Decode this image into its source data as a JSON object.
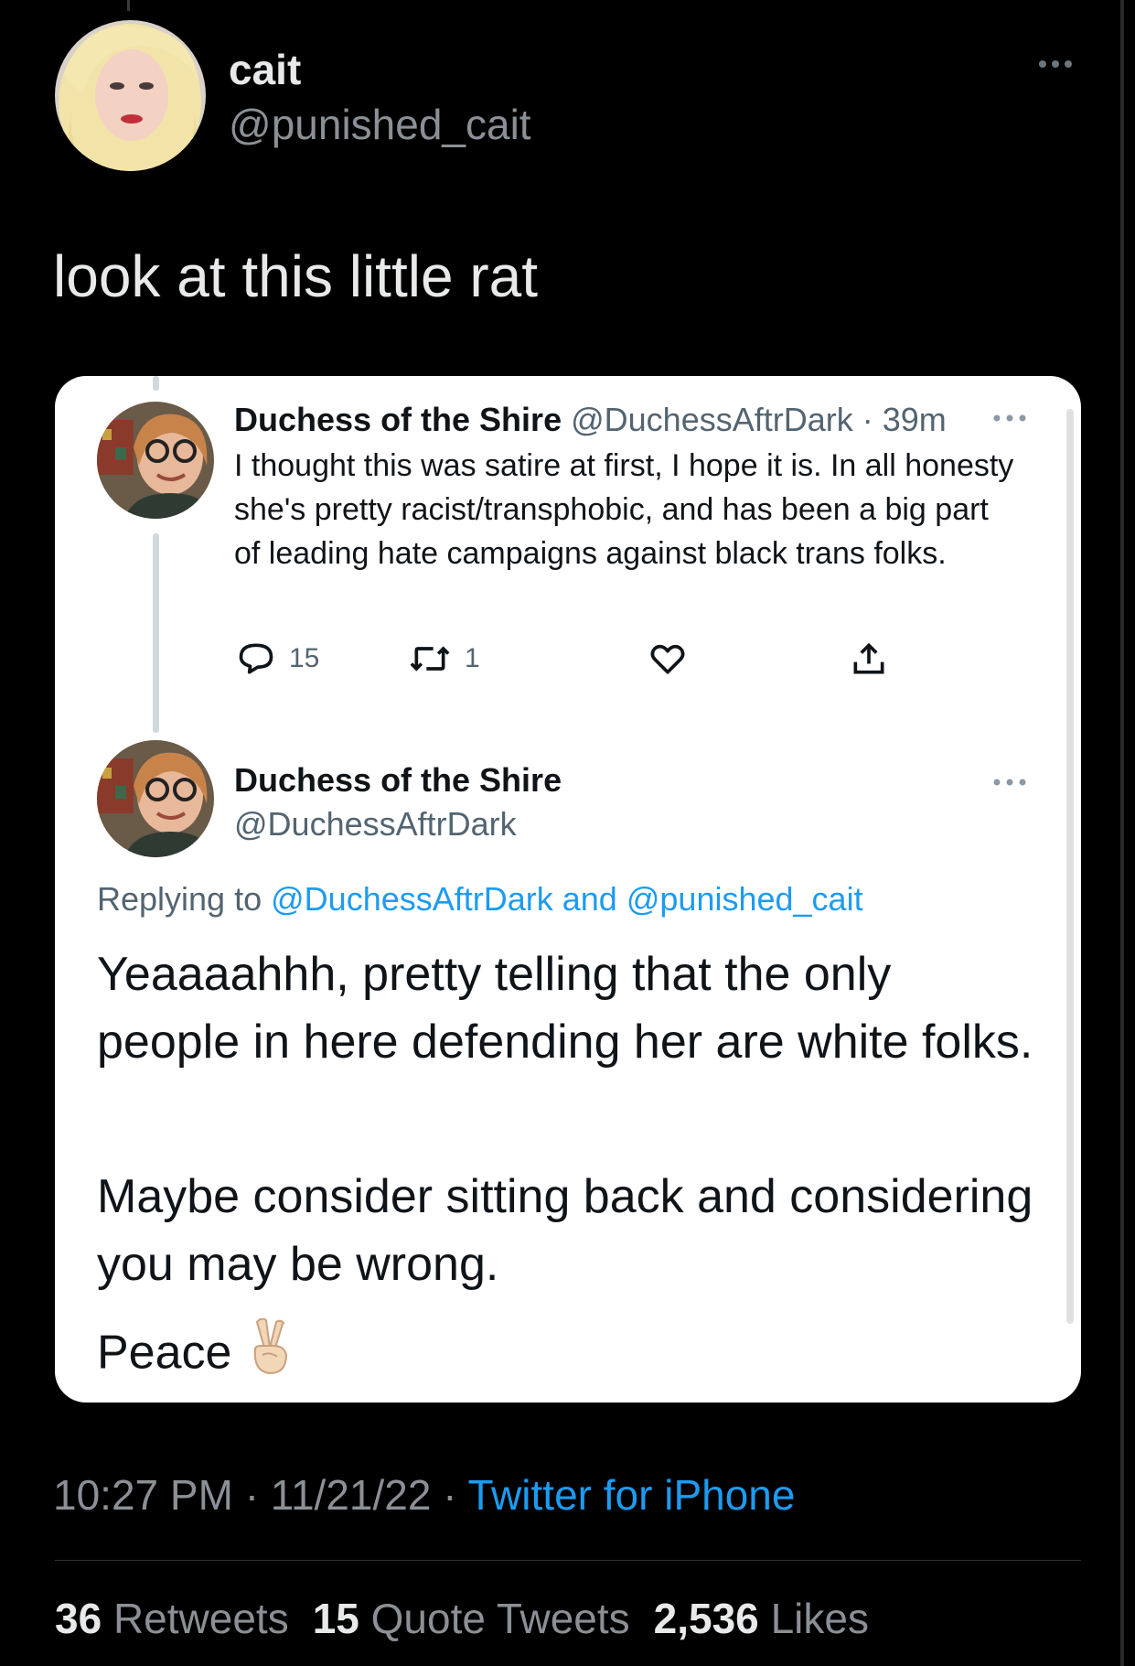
{
  "tweet": {
    "author_name": "cait",
    "author_handle": "@punished_cait",
    "text": "look at this little rat",
    "time": "10:27 PM",
    "separator": "·",
    "date": "11/21/22",
    "source": "Twitter for iPhone",
    "stats": {
      "retweets_count": "36",
      "retweets_label": "Retweets",
      "quotes_count": "15",
      "quotes_label": "Quote Tweets",
      "likes_count": "2,536",
      "likes_label": "Likes"
    },
    "more_icon": "more-horizontal-icon"
  },
  "embedded": {
    "reply": {
      "name": "Duchess of the Shire",
      "handle": "@DuchessAftrDark",
      "separator": "·",
      "time": "39m",
      "text": "I thought this was satire at first, I hope it is. In all honesty she's pretty racist/transphobic, and has been a big part of leading hate campaigns against black trans folks.",
      "actions": {
        "replies": "15",
        "retweets": "1"
      }
    },
    "main": {
      "name": "Duchess of the Shire",
      "handle": "@DuchessAftrDark",
      "replying_prefix": "Replying to",
      "replying_to_1": "@DuchessAftrDark",
      "replying_and": "and",
      "replying_to_2": "@punished_cait",
      "paragraphs": [
        "Yeaaaahhh, pretty telling that the only people in here defending her are white folks.",
        "Maybe consider sitting back and considering you may be wrong.",
        "Peace"
      ],
      "emoji": "victory-hand-emoji"
    }
  },
  "colors": {
    "background": "#000000",
    "card": "#ffffff",
    "link": "#1d9bf0",
    "muted_dark": "#8b9096",
    "muted_light": "#536471",
    "text_dark": "#0f1419",
    "text_light": "#e7e9ea"
  }
}
